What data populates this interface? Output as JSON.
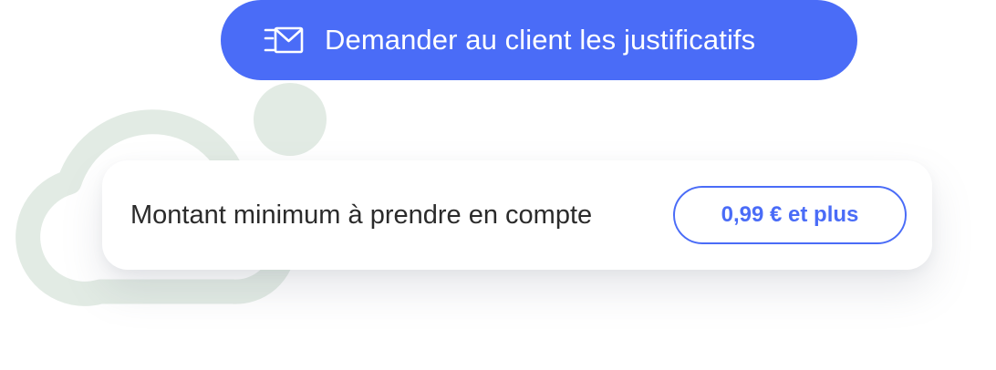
{
  "colors": {
    "accent": "#4a6cf7",
    "cloud": "#e2ebe4",
    "text": "#2b2b2b",
    "card_background": "#ffffff"
  },
  "request_button": {
    "icon": "envelope-send-icon",
    "label": "Demander au client les justificatifs"
  },
  "filter_card": {
    "label": "Montant minimum à prendre en compte",
    "amount_value": "0,99 € et plus"
  }
}
